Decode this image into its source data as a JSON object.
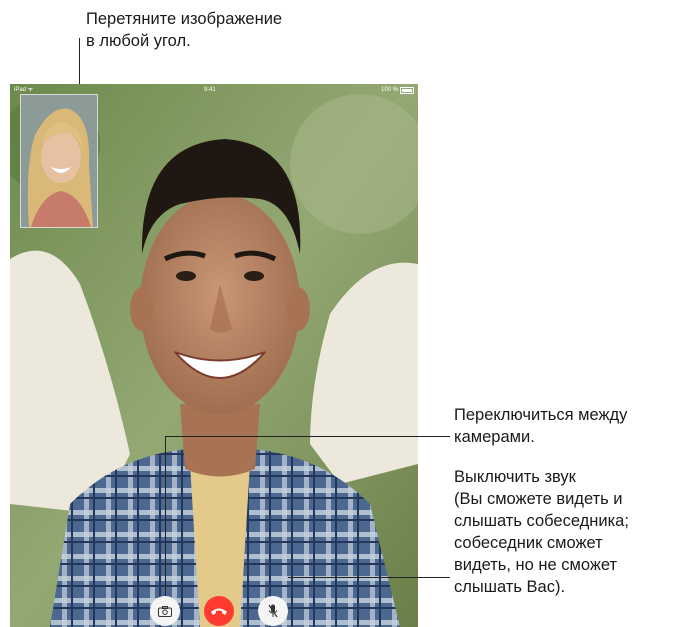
{
  "callouts": {
    "drag": [
      "Перетяните изображение",
      "в любой угол."
    ],
    "switch": [
      "Переключиться между",
      "камерами."
    ],
    "mute": [
      "Выключить звук",
      "(Вы сможете видеть и",
      "слышать собеседника;",
      "собеседник сможет",
      "видеть, но не сможет",
      "слышать Вас)."
    ]
  },
  "statusbar": {
    "left": "iPad ᯤ",
    "center": "9:41",
    "right": "100 %"
  },
  "controls": {
    "switch_camera": "camera-switch-icon",
    "end_call": "phone-down-icon",
    "mute": "microphone-icon"
  },
  "colors": {
    "end_call": "#ff3b30",
    "control_bg": "#f5f5f5"
  }
}
